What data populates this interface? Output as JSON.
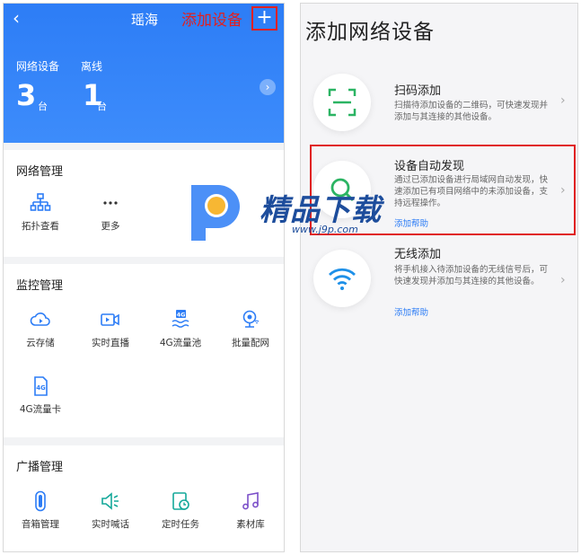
{
  "left": {
    "header": {
      "title": "瑶海",
      "back_icon": "chevron-left-icon",
      "add_icon": "plus-icon"
    },
    "annotation": {
      "label": "添加设备",
      "color": "#e02020"
    },
    "stats": [
      {
        "label": "网络设备",
        "value": "3",
        "unit": "台"
      },
      {
        "label": "离线",
        "value": "1",
        "unit": "台"
      }
    ],
    "sections": {
      "network": {
        "title": "网络管理",
        "items": [
          {
            "label": "拓扑查看",
            "icon": "topology-icon"
          },
          {
            "label": "更多",
            "icon": "more-icon"
          }
        ]
      },
      "monitor": {
        "title": "监控管理",
        "items": [
          {
            "label": "云存储",
            "icon": "cloud-play-icon"
          },
          {
            "label": "实时直播",
            "icon": "live-video-icon"
          },
          {
            "label": "4G流量池",
            "icon": "4g-pool-icon",
            "badge": "4G"
          },
          {
            "label": "批量配网",
            "icon": "camera-config-icon"
          },
          {
            "label": "4G流量卡",
            "icon": "4g-card-icon",
            "badge": "4G"
          }
        ]
      },
      "broadcast": {
        "title": "广播管理",
        "items": [
          {
            "label": "音箱管理",
            "icon": "speaker-icon"
          },
          {
            "label": "实时喊话",
            "icon": "megaphone-icon"
          },
          {
            "label": "定时任务",
            "icon": "timer-task-icon"
          },
          {
            "label": "素材库",
            "icon": "music-library-icon"
          }
        ]
      }
    },
    "colors": {
      "accent": "#2d7df6",
      "icon_blue": "#2d7df6",
      "icon_teal": "#14a89a",
      "icon_purple": "#7b4fc9"
    }
  },
  "right": {
    "title": "添加网络设备",
    "options": [
      {
        "name": "扫码添加",
        "desc": "扫描待添加设备的二维码，可快速发现并添加与其连接的其他设备。",
        "help": "",
        "icon": "scan-code-icon"
      },
      {
        "name": "设备自动发现",
        "desc": "通过已添加设备进行局域网自动发现，快速添加已有项目网络中的未添加设备，支持远程操作。",
        "help": "添加帮助",
        "icon": "search-icon"
      },
      {
        "name": "无线添加",
        "desc": "将手机接入待添加设备的无线信号后，可快速发现并添加与其连接的其他设备。",
        "help": "添加帮助",
        "icon": "wifi-icon"
      }
    ],
    "colors": {
      "icon_green": "#2bb463",
      "icon_blue": "#1e90e8"
    }
  },
  "watermark": {
    "text": "精品下载",
    "url": "www.j9p.com",
    "icon": "j9p-logo-icon"
  }
}
